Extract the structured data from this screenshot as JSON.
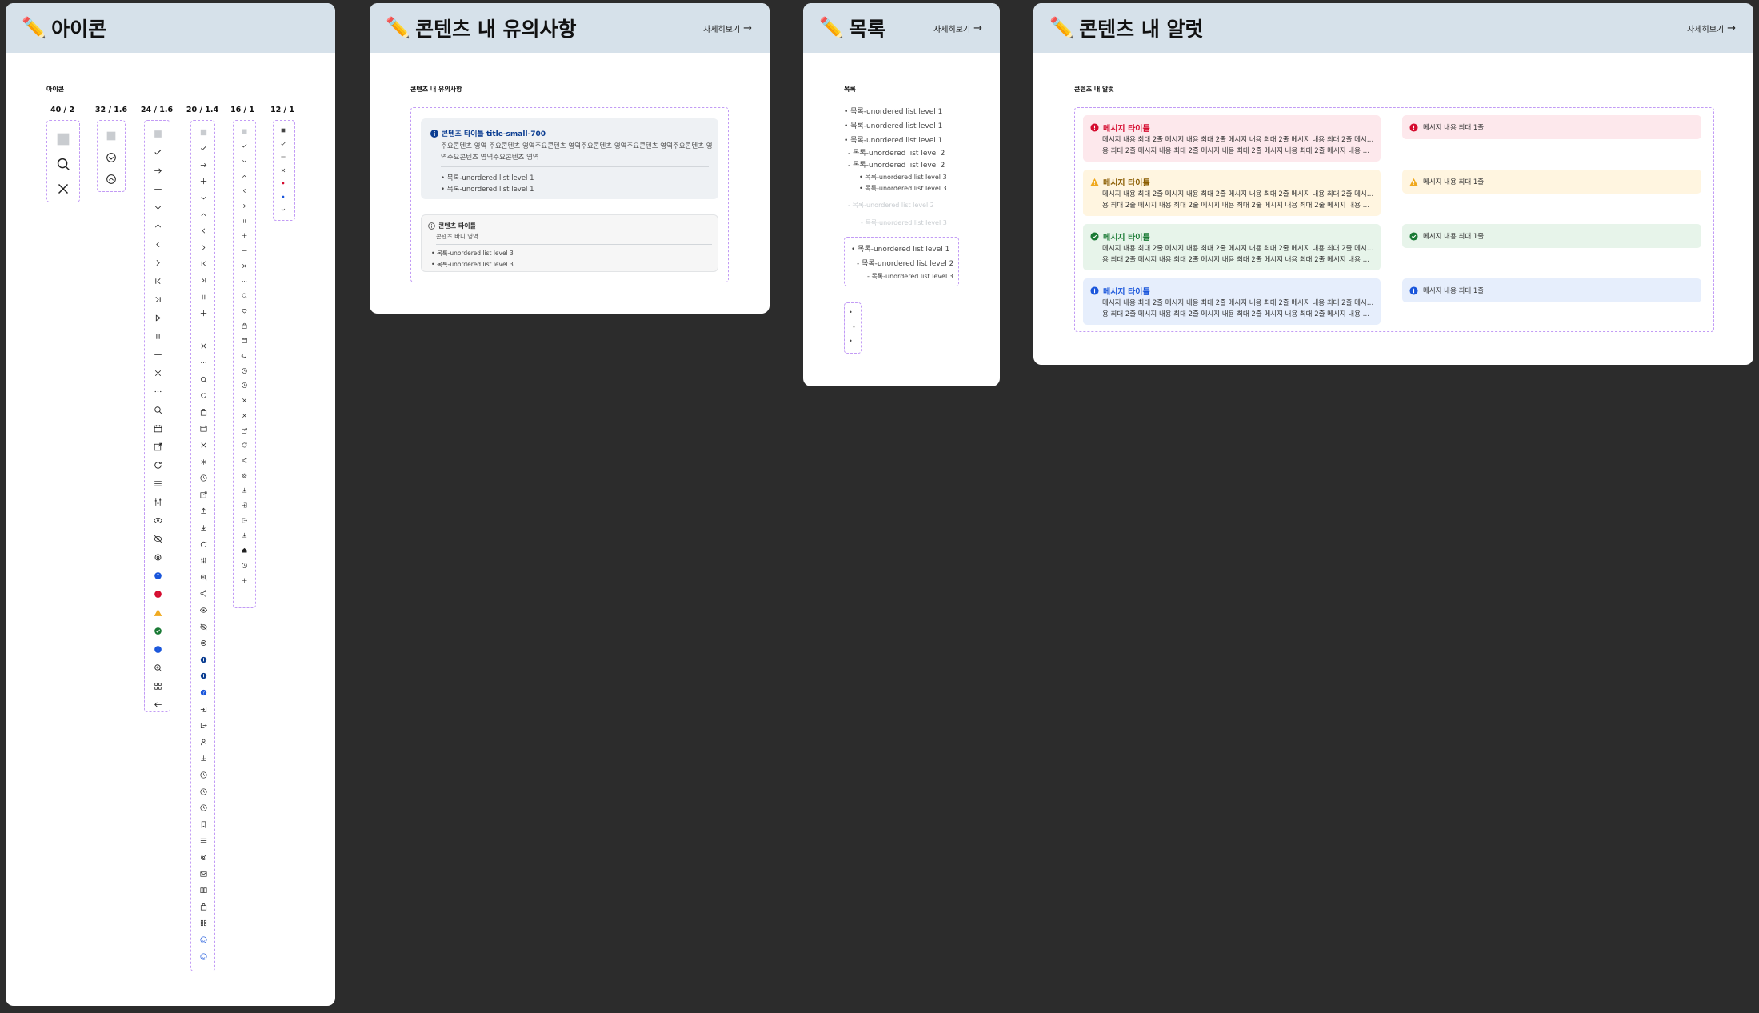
{
  "icons_frame": {
    "title": "아이콘",
    "section_label": "아이콘",
    "columns": [
      "40 / 2",
      "32 / 1.6",
      "24 / 1.6",
      "20 / 1.4",
      "16 / 1",
      "12 / 1"
    ]
  },
  "notice_frame": {
    "title": "콘텐츠 내 유의사항",
    "more": "자세히보기",
    "section_label": "콘텐츠 내 유의사항",
    "box1": {
      "title": "콘텐츠 타이틀 title-small-700",
      "body_line1": "주요콘텐츠 영역 주요콘텐츠 영역주요콘텐츠 영역주요콘텐츠 영역주요콘텐츠 영역주요콘텐츠 영",
      "body_line2": "역주요콘텐츠 영역주요콘텐츠 영역",
      "items": [
        "목록-unordered list level 1",
        "목록-unordered list level 1"
      ]
    },
    "box2": {
      "title": "콘텐츠 타이틀",
      "body": "콘텐츠 바디 영역",
      "items": [
        "목록-unordered list level 3",
        "목록-unordered list level 3"
      ]
    }
  },
  "list_frame": {
    "title": "목록",
    "more": "자세히보기",
    "section_label": "목록",
    "items": [
      "목록-unordered list level 1",
      "목록-unordered list level 1",
      "목록-unordered list level 1",
      "목록-unordered list level 2",
      "목록-unordered list level 2",
      "목록-unordered list level 3",
      "목록-unordered list level 3",
      "목록-unordered list level 2",
      "목록-unordered list level 3"
    ],
    "boxed_items": [
      "목록-unordered list level 1",
      "목록-unordered list level 2",
      "목록-unordered list level 3"
    ]
  },
  "alert_frame": {
    "title": "콘텐츠 내 알럿",
    "more": "자세히보기",
    "section_label": "콘텐츠 내 알럿",
    "alerts": [
      {
        "title": "메시지 타이틀",
        "line1": "메시지 내용 최대 2줄 메시지 내용 최대 2줄 메시지 내용 최대 2줄 메시지 내용 최대 2줄 메시지 내",
        "line2": "용 최대 2줄 메시지 내용 최대 2줄 메시지 내용 최대 2줄 메시지 내용 최대 2줄 메시지 내용 최대 2줄 메시지 내용",
        "short": "메시지 내용 최대 1줄",
        "bg": "#fde8ec",
        "color": "#d50c2f"
      },
      {
        "title": "메시지 타이틀",
        "line1": "메시지 내용 최대 2줄 메시지 내용 최대 2줄 메시지 내용 최대 2줄 메시지 내용 최대 2줄 메시지 내",
        "line2": "용 최대 2줄 메시지 내용 최대 2줄 메시지 내용 최대 2줄 메시지 내용 최대 2줄 메시지 내용 최대 2줄 메시지 내용",
        "short": "메시지 내용 최대 1줄",
        "bg": "#fff5e0",
        "color": "#8a5c00"
      },
      {
        "title": "메시지 타이틀",
        "line1": "메시지 내용 최대 2줄 메시지 내용 최대 2줄 메시지 내용 최대 2줄 메시지 내용 최대 2줄 메시지 내",
        "line2": "용 최대 2줄 메시지 내용 최대 2줄 메시지 내용 최대 2줄 메시지 내용 최대 2줄 메시지 내용 최대 2줄 메시지 내용",
        "short": "메시지 내용 최대 1줄",
        "bg": "#e7f4ea",
        "color": "#1a7a35"
      },
      {
        "title": "메시지 타이틀",
        "line1": "메시지 내용 최대 2줄 메시지 내용 최대 2줄 메시지 내용 최대 2줄 메시지 내용 최대 2줄 메시지 내",
        "line2": "용 최대 2줄 메시지 내용 최대 2줄 메시지 내용 최대 2줄 메시지 내용 최대 2줄 메시지 내용 최대 2줄 메시지 내용",
        "short": "메시지 내용 최대 1줄",
        "bg": "#e6eefc",
        "color": "#1a56db"
      }
    ]
  },
  "colors": {
    "frame_header": "#d6e1ea",
    "dash_border": "#c29bf5",
    "canvas": "#2c2c2c"
  }
}
